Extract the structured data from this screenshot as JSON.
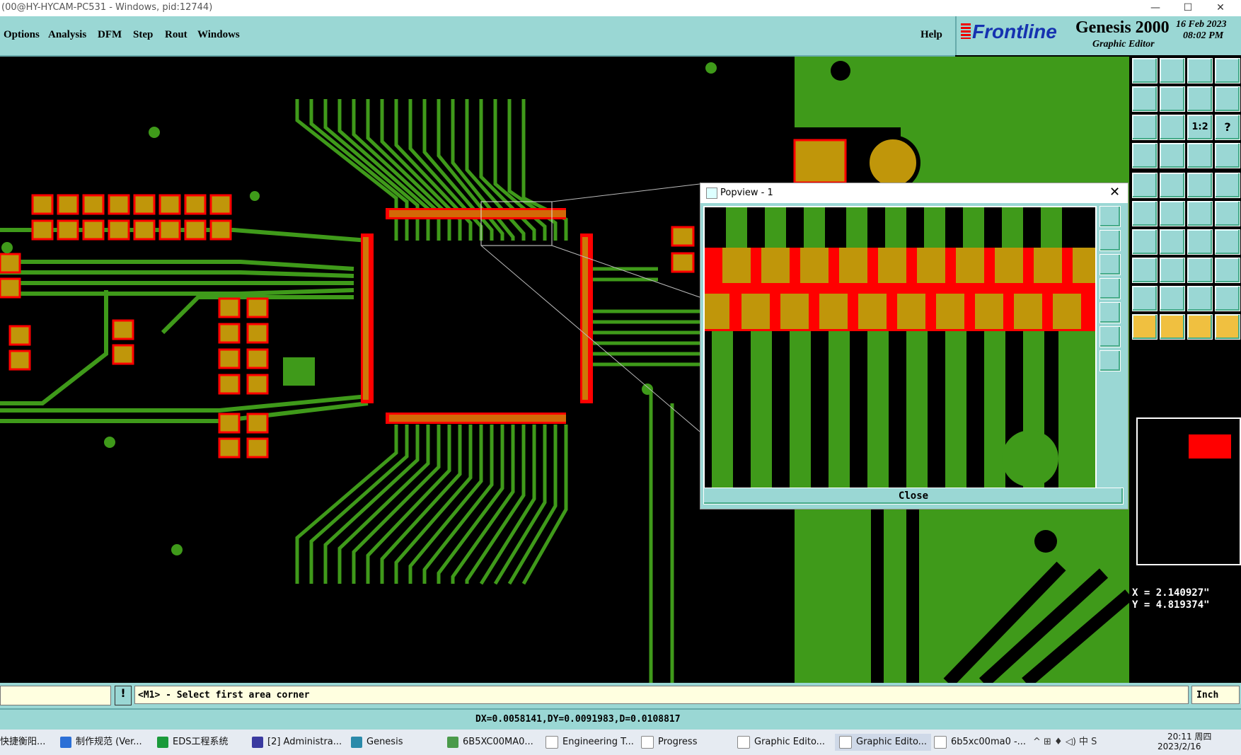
{
  "os": {
    "title": "(00@HY-HYCAM-PC531 - Windows, pid:12744)"
  },
  "menu": {
    "items": [
      "Options",
      "Analysis",
      "DFM",
      "Step",
      "Rout",
      "Windows"
    ],
    "help": "Help"
  },
  "brand": {
    "logo": "Frontline",
    "product": "Genesis 2000",
    "subtitle": "Graphic Editor",
    "date": "16 Feb 2023",
    "time": "08:02 PM"
  },
  "popview": {
    "title": "Popview - 1",
    "close_label": "Close"
  },
  "readout": {
    "x": "X = 2.140927\"",
    "y": "Y = 4.819374\""
  },
  "status": {
    "prompt": "<M1> - Select first area corner",
    "units": "Inch",
    "measure": "DX=0.0058141,DY=0.0091983,D=0.0108817"
  },
  "taskbar": {
    "items": [
      "快捷衡阳...",
      "制作规范 (Ver...",
      "EDS工程系统",
      "[2] Administra...",
      "Genesis",
      "6B5XC00MA0...",
      "Engineering T...",
      "Progress",
      "Graphic Edito...",
      "Graphic Edito...",
      "6b5xc00ma0 -..."
    ],
    "clock": "20:11 周四",
    "date": "2023/2/16"
  },
  "colors": {
    "panel": "#9ad7d4",
    "copper": "#3f9a1a",
    "pad": "#c0960a",
    "mask": "#ff0000"
  }
}
